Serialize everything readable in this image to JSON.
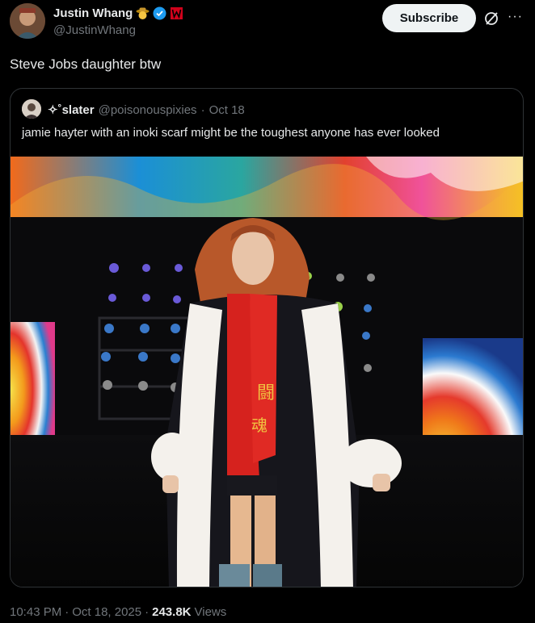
{
  "author": {
    "name": "Justin Whang",
    "handle": "@JustinWhang",
    "verified": true,
    "badges": [
      "cowboy-emoji-icon",
      "verified-badge-icon",
      "wwe-logo-icon"
    ],
    "accent": "#1d9bf0"
  },
  "actions": {
    "subscribe_label": "Subscribe",
    "grok_icon": "grok-icon",
    "more_icon": "more-icon",
    "more_glyph": "···"
  },
  "post": {
    "text": "Steve Jobs daughter btw"
  },
  "quote": {
    "name": "✧˚slater",
    "handle": "@poisonouspixies",
    "separator": "·",
    "date": "Oct 18",
    "text": "jamie hayter with an inoki scarf might be the toughest anyone has ever looked",
    "media_alt": "wrestler with red hair wearing a red scarf and white fur-trimmed black robe on a stage with colorful screens"
  },
  "meta": {
    "time": "10:43 PM",
    "sep1": "·",
    "date": "Oct 18, 2025",
    "sep2": "·",
    "views_count": "243.8K",
    "views_label": "Views"
  }
}
